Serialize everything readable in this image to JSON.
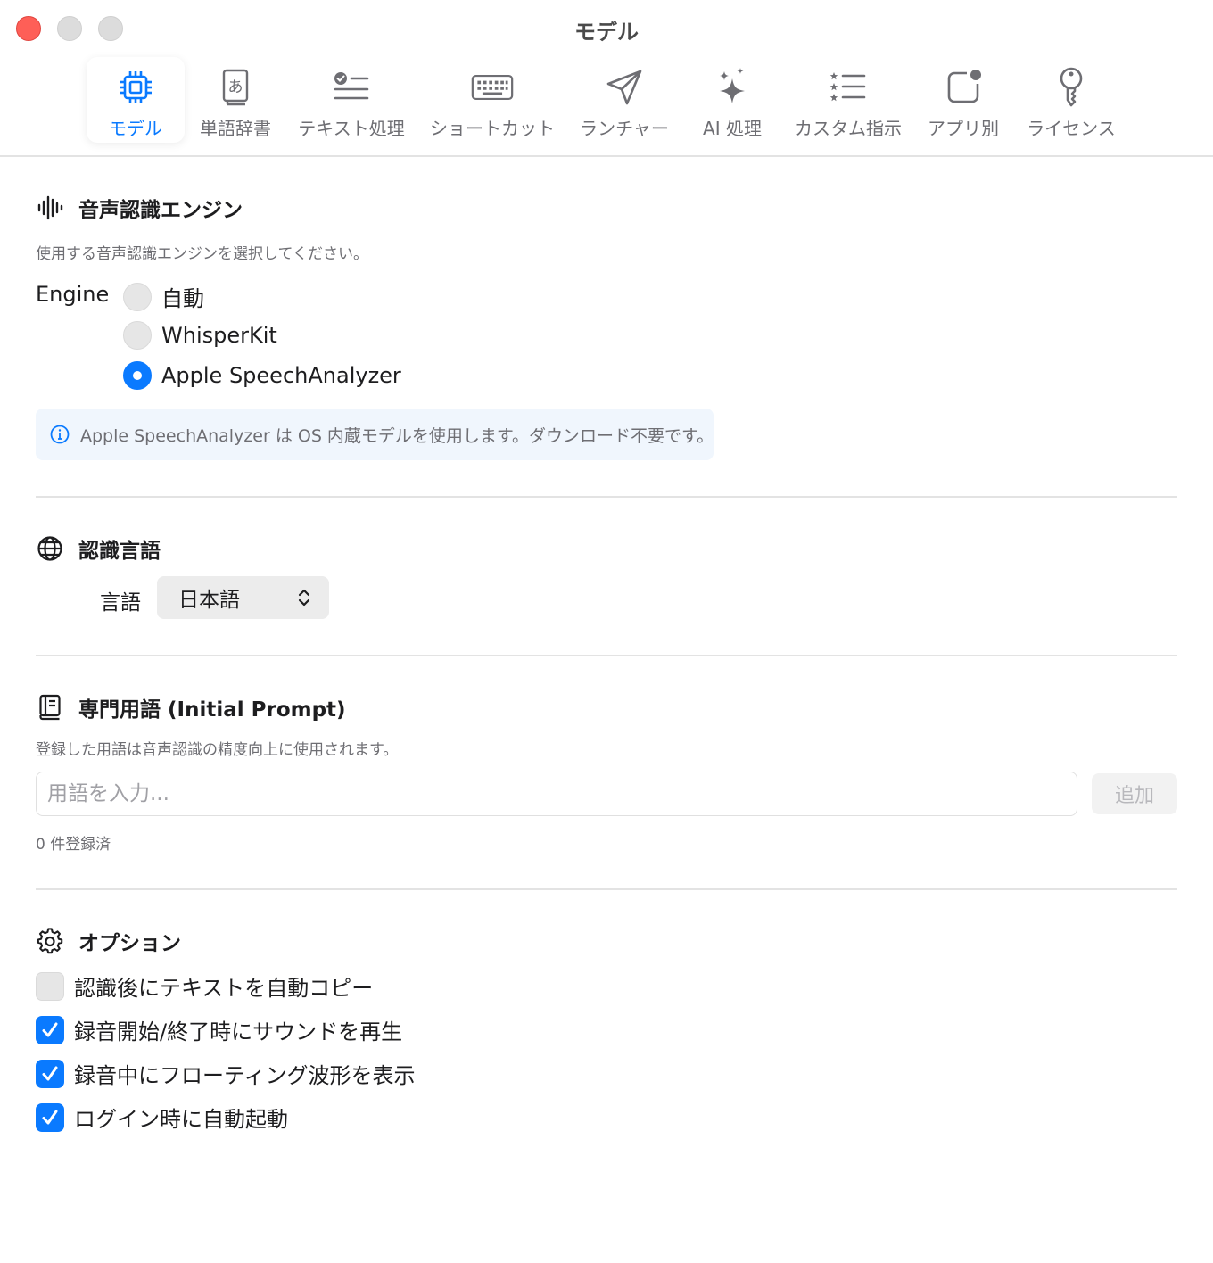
{
  "window": {
    "title": "モデル"
  },
  "colors": {
    "accent": "#0a7aff",
    "close": "#fe5f57",
    "info_bg": "#f0f6fd"
  },
  "tabs": [
    {
      "label": "モデル",
      "icon": "cpu-icon",
      "active": true
    },
    {
      "label": "単語辞書",
      "icon": "dictionary-book-icon",
      "active": false
    },
    {
      "label": "テキスト処理",
      "icon": "checklist-icon",
      "active": false
    },
    {
      "label": "ショートカット",
      "icon": "keyboard-icon",
      "active": false
    },
    {
      "label": "ランチャー",
      "icon": "paper-plane-icon",
      "active": false
    },
    {
      "label": "AI 処理",
      "icon": "sparkles-icon",
      "active": false
    },
    {
      "label": "カスタム指示",
      "icon": "list-star-icon",
      "active": false
    },
    {
      "label": "アプリ別",
      "icon": "app-badge-icon",
      "active": false
    },
    {
      "label": "ライセンス",
      "icon": "key-icon",
      "active": false
    }
  ],
  "engine_section": {
    "title": "音声認識エンジン",
    "icon": "waveform-icon",
    "description": "使用する音声認識エンジンを選択してください。",
    "field_label": "Engine",
    "options": [
      {
        "label": "自動",
        "selected": false
      },
      {
        "label": "WhisperKit",
        "selected": false
      },
      {
        "label": "Apple SpeechAnalyzer",
        "selected": true
      }
    ],
    "info": "Apple SpeechAnalyzer は OS 内蔵モデルを使用します。ダウンロード不要です。"
  },
  "language_section": {
    "title": "認識言語",
    "icon": "globe-icon",
    "field_label": "言語",
    "selected": "日本語"
  },
  "terms_section": {
    "title": "専門用語 (Initial Prompt)",
    "icon": "book-icon",
    "description": "登録した用語は音声認識の精度向上に使用されます。",
    "input_value": "",
    "input_placeholder": "用語を入力...",
    "add_label": "追加",
    "count_text": "0 件登録済"
  },
  "options_section": {
    "title": "オプション",
    "icon": "gear-icon",
    "items": [
      {
        "label": "認識後にテキストを自動コピー",
        "checked": false
      },
      {
        "label": "録音開始/終了時にサウンドを再生",
        "checked": true
      },
      {
        "label": "録音中にフローティング波形を表示",
        "checked": true
      },
      {
        "label": "ログイン時に自動起動",
        "checked": true
      }
    ]
  }
}
